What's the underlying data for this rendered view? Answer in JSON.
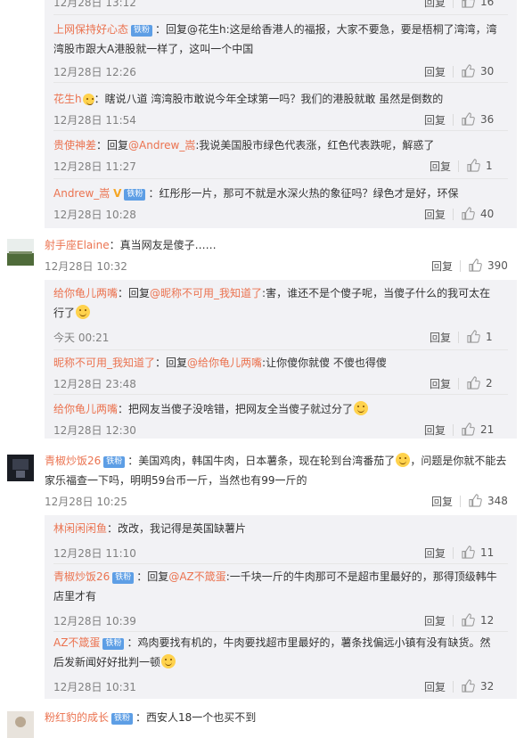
{
  "top_partial": {
    "time": "12月28日 13:12",
    "reply": "回复",
    "likes": "16"
  },
  "replies1": [
    {
      "user": "上网保持好心态",
      "badge": "铁粉",
      "line1": "：回复@花生h:这是给香港人的福报，大家不要急，要是梧桐了湾湾，湾",
      "line2": "湾股市跟大A港股就一样了，这叫一个中国",
      "time": "12月28日 12:26",
      "reply": "回复",
      "likes": "30"
    },
    {
      "user": "花生h",
      "text": "：瞎说八道 湾湾股市敢说今年全球第一吗？我们的港股就敢 虽然是倒数的",
      "time": "12月28日 11:54",
      "reply": "回复",
      "likes": "36"
    },
    {
      "user": "贵使神差",
      "text_pre": "：回复",
      "mention": "@Andrew_嵩",
      "text_post": ":我说美国股市绿色代表涨，红色代表跌呢，解惑了",
      "time": "12月28日 11:27",
      "reply": "回复",
      "likes": "1"
    },
    {
      "user": "Andrew_嵩",
      "vip": "V",
      "badge": "铁粉",
      "text": "：红彤彤一片，那可不就是水深火热的象征吗？绿色才是好，环保",
      "time": "12月28日 10:28",
      "reply": "回复",
      "likes": "40"
    }
  ],
  "comment2": {
    "user": "射手座Elaine",
    "text": "：真当网友是傻子……",
    "time": "12月28日 10:32",
    "reply": "回复",
    "likes": "390"
  },
  "replies2": [
    {
      "user": "给你龟儿两嘴",
      "text_pre": "：回复",
      "mention": "@昵称不可用_我知道了",
      "line1_post": ":害，谁还不是个傻子呢，当傻子什么的我可太在",
      "line2": "行了",
      "time": "今天 00:21",
      "reply": "回复",
      "likes": "1"
    },
    {
      "user": "昵称不可用_我知道了",
      "text_pre": "：回复",
      "mention": "@给你龟儿两嘴",
      "text_post": ":让你傻你就傻 不傻也得傻",
      "time": "12月28日 23:48",
      "reply": "回复",
      "likes": "2"
    },
    {
      "user": "给你龟儿两嘴",
      "text": "：把网友当傻子没啥错，把网友全当傻子就过分了",
      "time": "12月28日 12:30",
      "reply": "回复",
      "likes": "21"
    }
  ],
  "comment3": {
    "user": "青椒炒饭26",
    "badge": "铁粉",
    "line1": "：美国鸡肉，韩国牛肉，日本薯条，现在轮到台湾番茄了",
    "line1_end": "，问题是你就不能去",
    "line2": "家乐福查一下吗，明明59台币一斤，当然也有99一斤的",
    "time": "12月28日 10:25",
    "reply": "回复",
    "likes": "348"
  },
  "replies3": [
    {
      "user": "林闲闲闲鱼",
      "text": "：改改，我记得是英国缺薯片",
      "time": "12月28日 11:10",
      "reply": "回复",
      "likes": "11"
    },
    {
      "user": "青椒炒饭26",
      "badge": "铁粉",
      "text_pre": "：回复",
      "mention": "@AZ不箴蛋",
      "line1_post": ":一千块一斤的牛肉那可不是超市里最好的，那得顶级韩牛",
      "line2": "店里才有",
      "time": "12月28日 10:39",
      "reply": "回复",
      "likes": "12"
    },
    {
      "user": "AZ不箴蛋",
      "badge": "铁粉",
      "line1": "：鸡肉要找有机的，牛肉要找超市里最好的，薯条找偏远小镇有没有缺货。然",
      "line2": "后发新闻好好批判一顿",
      "time": "12月28日 10:31",
      "reply": "回复",
      "likes": "32"
    }
  ],
  "comment4": {
    "user": "粉红豹的成长",
    "badge": "铁粉",
    "text": "：西安人18一个也买不到"
  }
}
